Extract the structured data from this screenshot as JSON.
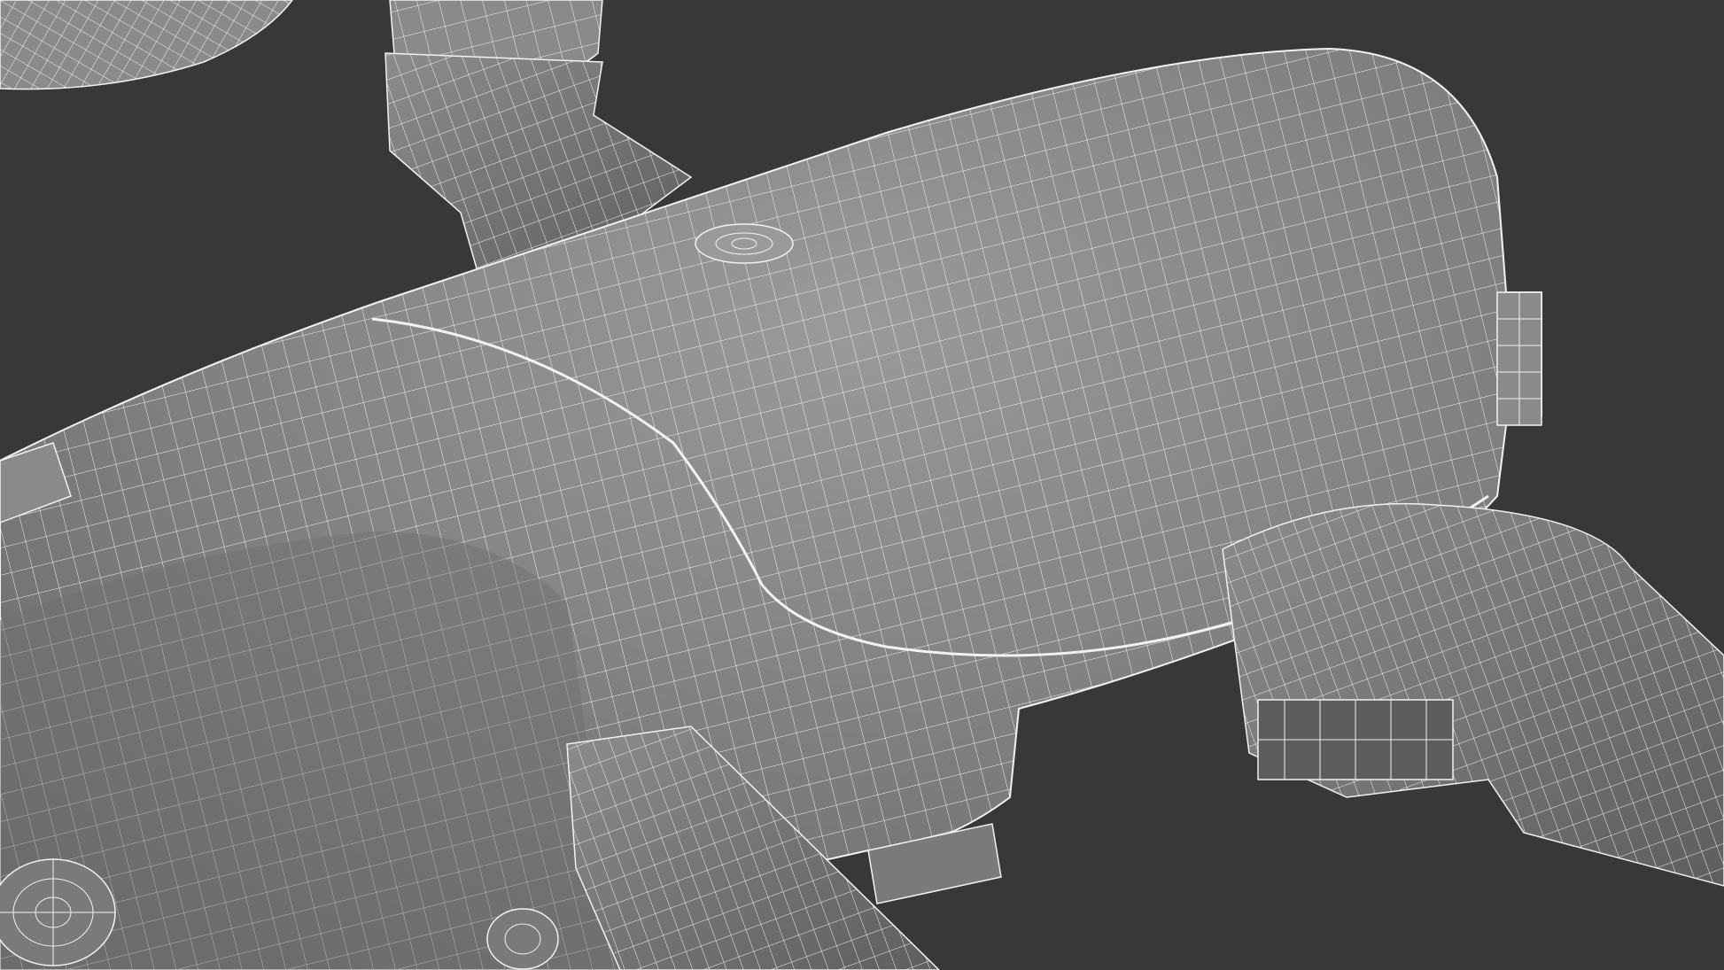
{
  "colors": {
    "background": "#383838",
    "body_fill": "#8a8a8a",
    "body_dark": "#6e6e6e",
    "shadow_fill": "#5c5c5c",
    "wire": "#f2f2f2"
  },
  "icons": [
    "drone-body-wireframe",
    "propeller-wireframe",
    "motor-wireframe",
    "arm-wireframe",
    "camera-gimbal-wireframe"
  ]
}
